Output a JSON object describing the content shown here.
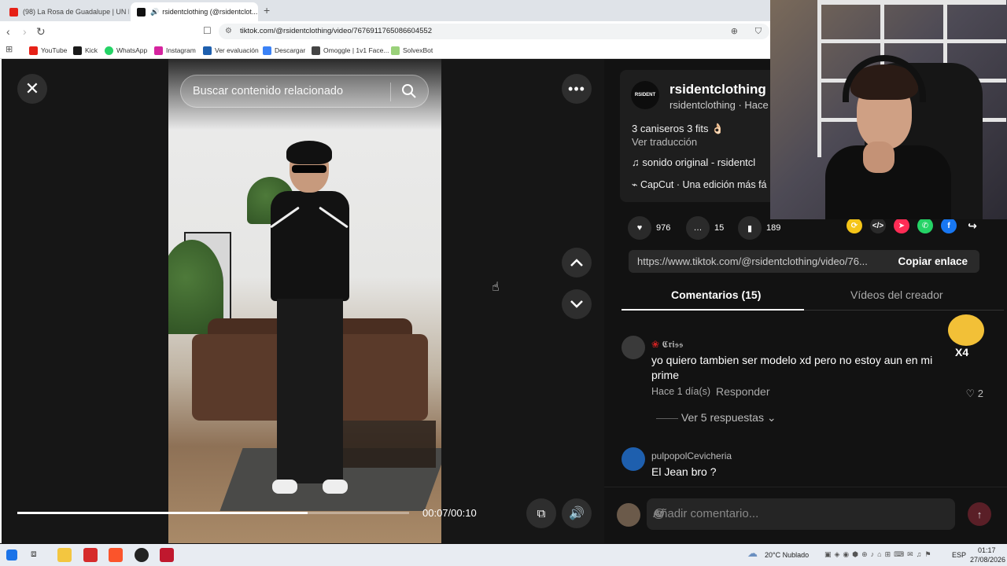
{
  "browser": {
    "tabs": [
      {
        "label": "(98) La Rosa de Guadalupe | UN MU...",
        "active": false
      },
      {
        "label": "rsidentclothing (@rsidentclot...",
        "active": true
      }
    ],
    "url": "tiktok.com/@rsidentclothing/video/7676911765086604552",
    "bookmarks": [
      "YouTube",
      "Kick",
      "WhatsApp",
      "Instagram",
      "Ver evaluación",
      "Descargar",
      "Omoggle | 1v1 Face...",
      "SolvexBot"
    ]
  },
  "player": {
    "search_placeholder": "Buscar contenido relacionado",
    "time": "00:07/00:10",
    "progress": 0.74
  },
  "post": {
    "logo_text": "RSIDENT",
    "username": "rsidentclothing",
    "subline": "rsidentclothing · Hace",
    "description": "3 caniseros 3 fits 👌🏻",
    "translate": "Ver traducción",
    "sound": "sonido original - rsidentcl",
    "capcut": "CapCut · Una edición más fá",
    "likes": "976",
    "comments": "15",
    "saves": "189",
    "link": "https://www.tiktok.com/@rsidentclothing/video/76...",
    "copy_label": "Copiar enlace"
  },
  "tabs": {
    "comments": "Comentarios (15)",
    "creator_videos": "Vídeos del creador"
  },
  "comments": [
    {
      "author": "𝕮𝖗𝖎𝖘𝖘",
      "text": "yo quiero tambien ser modelo xd pero no estoy aun en mi prime",
      "time": "Hace 1 día(s)",
      "reply": "Responder",
      "likes": "2",
      "replies": "Ver 5 respuestas"
    },
    {
      "author": "pulpopolCevicheria",
      "text": "El Jean bro ?"
    }
  ],
  "compose": {
    "placeholder": "Añadir comentario..."
  },
  "overlay": {
    "sticker_text": "X4"
  },
  "taskbar": {
    "weather": "20°C  Nublado",
    "lang": "ESP",
    "time": "01:17",
    "date": "27/08/2026"
  }
}
